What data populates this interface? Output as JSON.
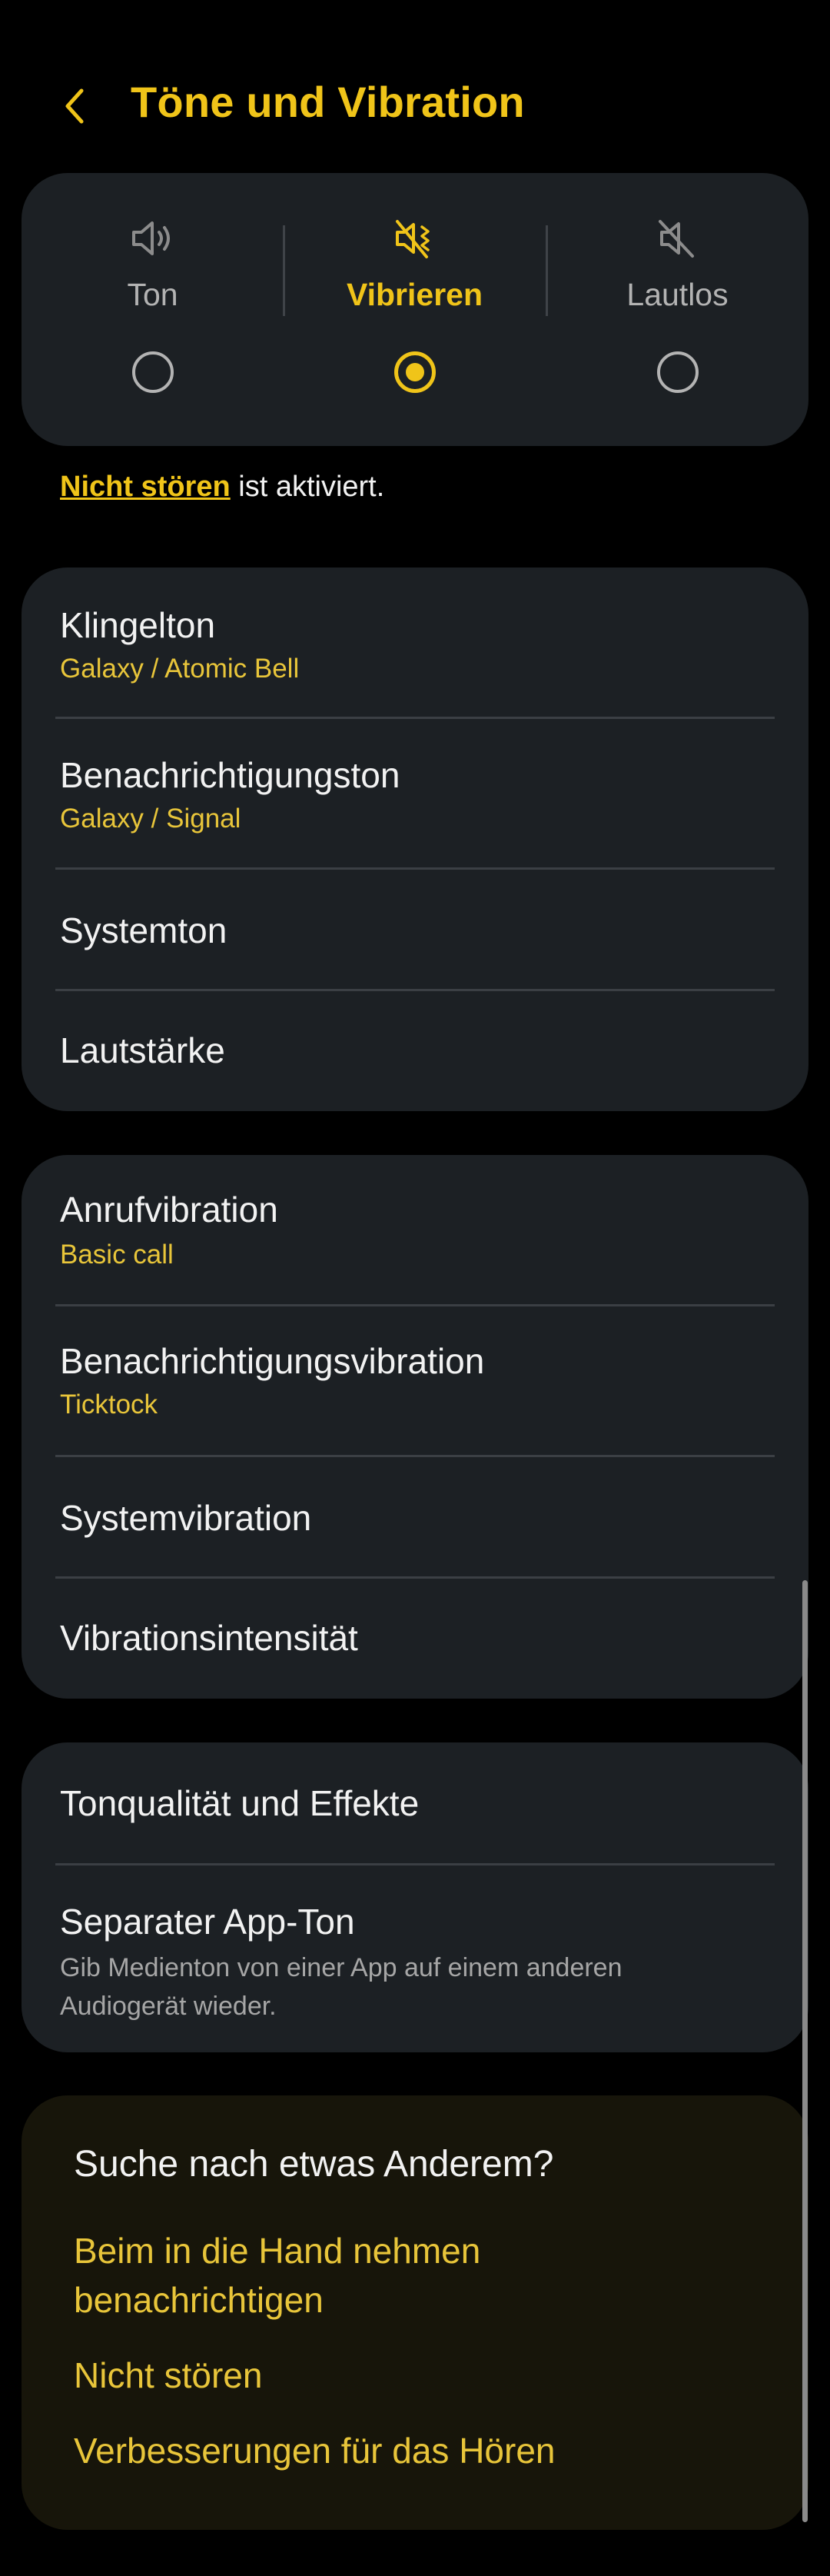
{
  "header": {
    "title": "Töne und Vibration"
  },
  "sound_mode": {
    "options": [
      {
        "label": "Ton",
        "icon": "speaker-icon",
        "selected": false
      },
      {
        "label": "Vibrieren",
        "icon": "vibrate-icon",
        "selected": true
      },
      {
        "label": "Lautlos",
        "icon": "mute-icon",
        "selected": false
      }
    ]
  },
  "dnd_notice": {
    "link": "Nicht stören",
    "text": " ist aktiviert."
  },
  "sound_group": {
    "items": [
      {
        "title": "Klingelton",
        "subtitle": "Galaxy / Atomic Bell"
      },
      {
        "title": "Benachrichtigungston",
        "subtitle": "Galaxy / Signal"
      },
      {
        "title": "Systemton"
      },
      {
        "title": "Lautstärke"
      }
    ]
  },
  "vibration_group": {
    "items": [
      {
        "title": "Anrufvibration",
        "subtitle": "Basic call"
      },
      {
        "title": "Benachrichtigungsvibration",
        "subtitle": "Ticktock"
      },
      {
        "title": "Systemvibration"
      },
      {
        "title": "Vibrationsintensität"
      }
    ]
  },
  "quality_group": {
    "items": [
      {
        "title": "Tonqualität und Effekte"
      },
      {
        "title": "Separater App-Ton",
        "description": "Gib Medienton von einer App auf einem anderen Audiogerät wieder."
      }
    ]
  },
  "suggestions": {
    "title": "Suche nach etwas Anderem?",
    "links": [
      "Beim in die Hand nehmen benachrichtigen",
      "Nicht stören",
      "Verbesserungen für das Hören"
    ]
  },
  "colors": {
    "accent": "#f0c419",
    "card": "#1c2024",
    "background": "#000000",
    "suggest_card": "#17150a"
  }
}
